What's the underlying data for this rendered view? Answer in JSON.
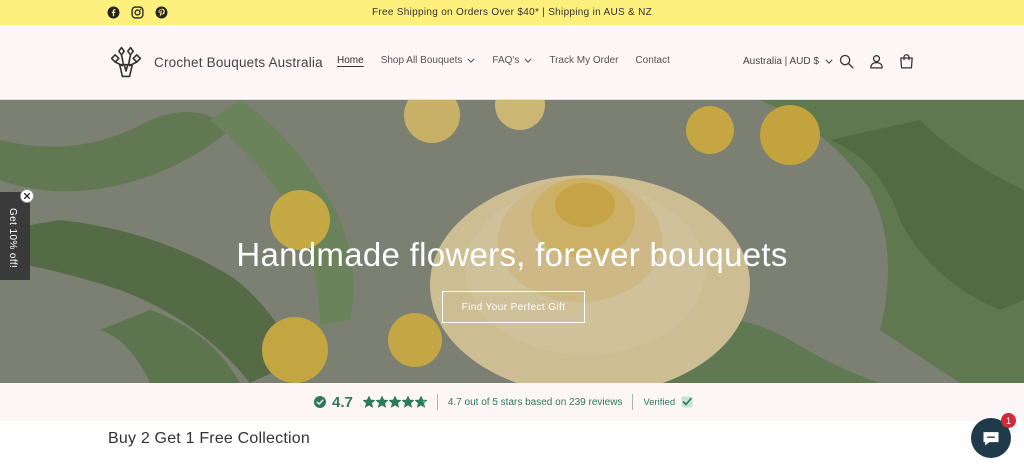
{
  "announcement": {
    "text": "Free Shipping on Orders Over $40* | Shipping in AUS & NZ"
  },
  "social": {
    "icons": [
      "facebook-icon",
      "instagram-icon",
      "pinterest-icon"
    ]
  },
  "header": {
    "brand": "Crochet Bouquets Australia",
    "nav": [
      {
        "label": "Home",
        "active": true
      },
      {
        "label": "Shop All Bouquets",
        "has_dropdown": true
      },
      {
        "label": "FAQ's",
        "has_dropdown": true
      },
      {
        "label": "Track My Order"
      },
      {
        "label": "Contact"
      }
    ],
    "region": "Australia | AUD $",
    "icons": [
      "search-icon",
      "account-icon",
      "cart-icon"
    ]
  },
  "hero": {
    "title": "Handmade flowers, forever bouquets",
    "button": "Find Your Perfect Gift"
  },
  "discount": {
    "label": "Get 10% off!"
  },
  "reviews": {
    "score": "4.7",
    "rating_value": 4.7,
    "rating_max": 5,
    "summary": "4.7 out of 5 stars based on 239 reviews",
    "verified": "Verified"
  },
  "collection": {
    "title": "Buy 2 Get 1 Free Collection"
  },
  "chat": {
    "badge": "1"
  },
  "colors": {
    "announcement_bg": "#fdf07c",
    "header_bg": "#fdf6f6",
    "review_green": "#2c7a5a",
    "chat_bg": "#1f3b4a",
    "badge_red": "#d02a3c"
  }
}
